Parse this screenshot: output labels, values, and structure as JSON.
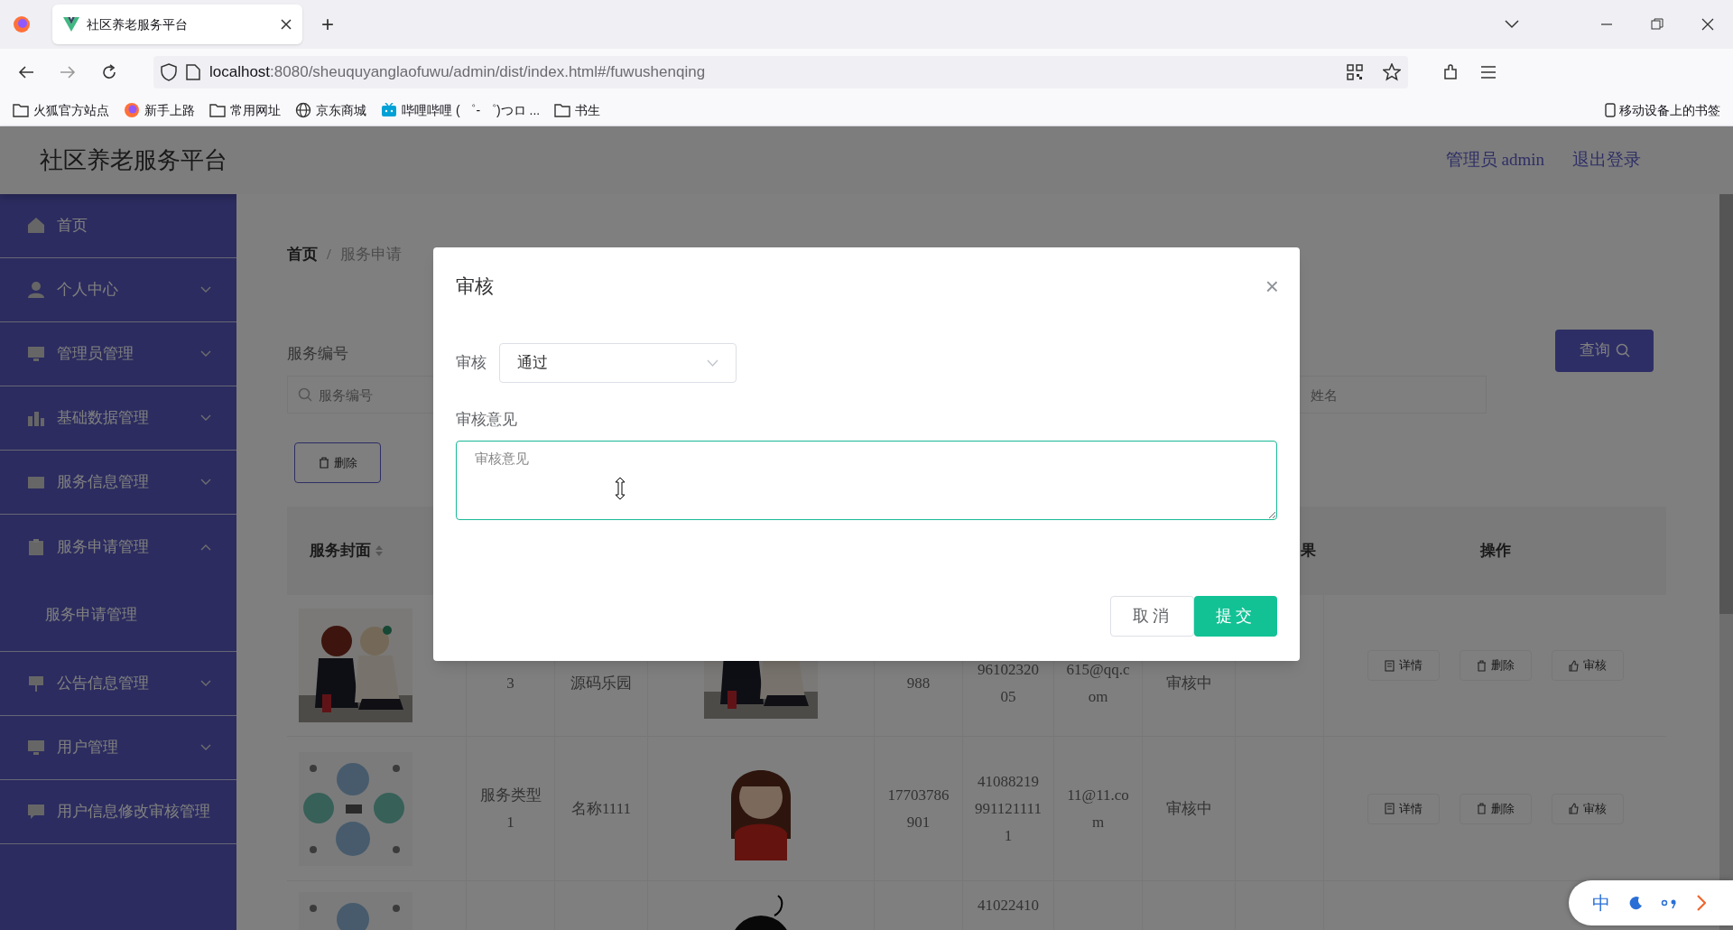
{
  "browser": {
    "tab_title": "社区养老服务平台",
    "new_tab": "+",
    "address": {
      "host": "localhost",
      "path": ":8080/sheuquyanglaofuwu/admin/dist/index.html#/fuwushenqing"
    },
    "bookmarks": [
      {
        "label": "火狐官方站点",
        "kind": "folder"
      },
      {
        "label": "新手上路",
        "kind": "firefox"
      },
      {
        "label": "常用网址",
        "kind": "folder"
      },
      {
        "label": "京东商城",
        "kind": "globe"
      },
      {
        "label": "哔哩哔哩 ( ゜- ゜)つロ ...",
        "kind": "tv"
      },
      {
        "label": "书生",
        "kind": "folder"
      }
    ],
    "mobile_bookmarks": "移动设备上的书签"
  },
  "header": {
    "title": "社区养老服务平台",
    "user": "管理员 admin",
    "logout": "退出登录"
  },
  "sidebar": {
    "items": [
      {
        "label": "首页",
        "kind": "home"
      },
      {
        "label": "个人中心",
        "kind": "user",
        "expanded": false
      },
      {
        "label": "管理员管理",
        "kind": "monitor",
        "expanded": false
      },
      {
        "label": "基础数据管理",
        "kind": "chart",
        "expanded": false
      },
      {
        "label": "服务信息管理",
        "kind": "card",
        "expanded": false
      },
      {
        "label": "服务申请管理",
        "kind": "clipboard",
        "expanded": true,
        "children": [
          {
            "label": "服务申请管理"
          }
        ]
      },
      {
        "label": "公告信息管理",
        "kind": "flag",
        "expanded": false
      },
      {
        "label": "用户管理",
        "kind": "monitor",
        "expanded": false
      },
      {
        "label": "用户信息修改审核管理",
        "kind": "chat"
      }
    ]
  },
  "breadcrumb": {
    "items": [
      "首页",
      "服务申请"
    ],
    "separator": "/"
  },
  "search": {
    "label": "服务编号",
    "fields": [
      {
        "placeholder": "服务编号"
      },
      {
        "placeholder": "姓名"
      }
    ],
    "query_button": "查询",
    "delete_button": "删除"
  },
  "table": {
    "columns": [
      {
        "label": "服务封面",
        "sortable": true
      },
      {},
      {},
      {},
      {},
      {},
      {},
      {},
      {
        "label": "果"
      },
      {
        "label": "操作"
      }
    ],
    "rows": [
      {
        "cells": [
          {
            "kind": "picture"
          },
          "3",
          "源码乐园",
          {
            "kind": "picture"
          },
          "988",
          "9610232005",
          "615@qq.com",
          "审核中",
          null
        ],
        "actions": [
          "详情",
          "删除",
          "审核"
        ]
      },
      {
        "cells": [
          {
            "kind": "picture"
          },
          "服务类型1",
          "名称1111",
          {
            "kind": "picture"
          },
          "17703786901",
          "410882199911211111",
          "11@11.com",
          "审核中",
          null
        ],
        "actions": [
          "详情",
          "删除",
          "审核"
        ]
      },
      {
        "cells": [
          {
            "kind": "picture"
          },
          null,
          null,
          {
            "kind": "picture"
          },
          null,
          "41022410",
          null,
          null,
          null
        ],
        "actions": []
      }
    ]
  },
  "dialog": {
    "title": "审核",
    "close": "×",
    "field_label": "审核",
    "select_value": "通过",
    "comment_label": "审核意见",
    "comment_placeholder": "审核意见",
    "cancel": "取消",
    "submit": "提交"
  },
  "ime": {
    "mode": "中"
  }
}
